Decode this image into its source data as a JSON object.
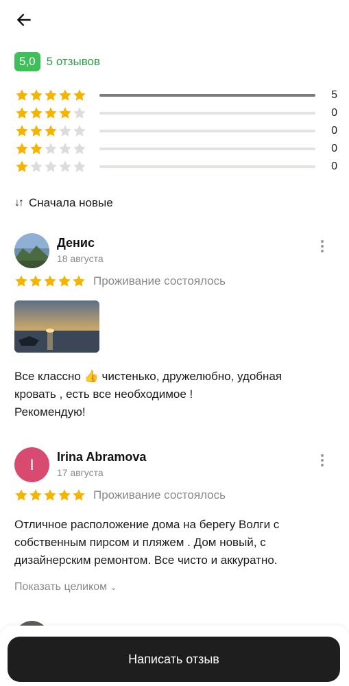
{
  "header": {
    "back_icon": "arrow-left-icon"
  },
  "rating": {
    "score": "5,0",
    "count_label": "5 отзывов",
    "badge_color": "#3fbf5a"
  },
  "distribution": [
    {
      "stars": 5,
      "count": "5",
      "fraction": 1.0
    },
    {
      "stars": 4,
      "count": "0",
      "fraction": 0
    },
    {
      "stars": 3,
      "count": "0",
      "fraction": 0
    },
    {
      "stars": 2,
      "count": "0",
      "fraction": 0
    },
    {
      "stars": 1,
      "count": "0",
      "fraction": 0
    }
  ],
  "sort": {
    "icon": "sort-arrows-icon",
    "label": "Сначала новые"
  },
  "reviews": [
    {
      "author": "Денис",
      "date": "18 августа",
      "rating": 5,
      "stay_label": "Проживание состоялось",
      "has_photo": true,
      "text_lines": [
        "Все классно 👍 чистенько, дружелюбно, удобная",
        "кровать , есть все необходимое !",
        "Рекомендую!"
      ]
    },
    {
      "author": "Irina Abramova",
      "avatar_letter": "I",
      "avatar_color": "#d84a70",
      "date": "17 августа",
      "rating": 5,
      "stay_label": "Проживание состоялось",
      "text_lines": [
        "Отличное расположение дома на берегу Волги с",
        "собственным пирсом и пляжем . Дом новый, с",
        "дизайнерским ремонтом. Все чисто и аккуратно."
      ],
      "show_more": "Показать целиком"
    }
  ],
  "footer": {
    "write_button": "Написать отзыв"
  },
  "colors": {
    "star": "#f5b400",
    "star_empty": "#dcdcdc",
    "primary_button": "#1e1e1e"
  }
}
